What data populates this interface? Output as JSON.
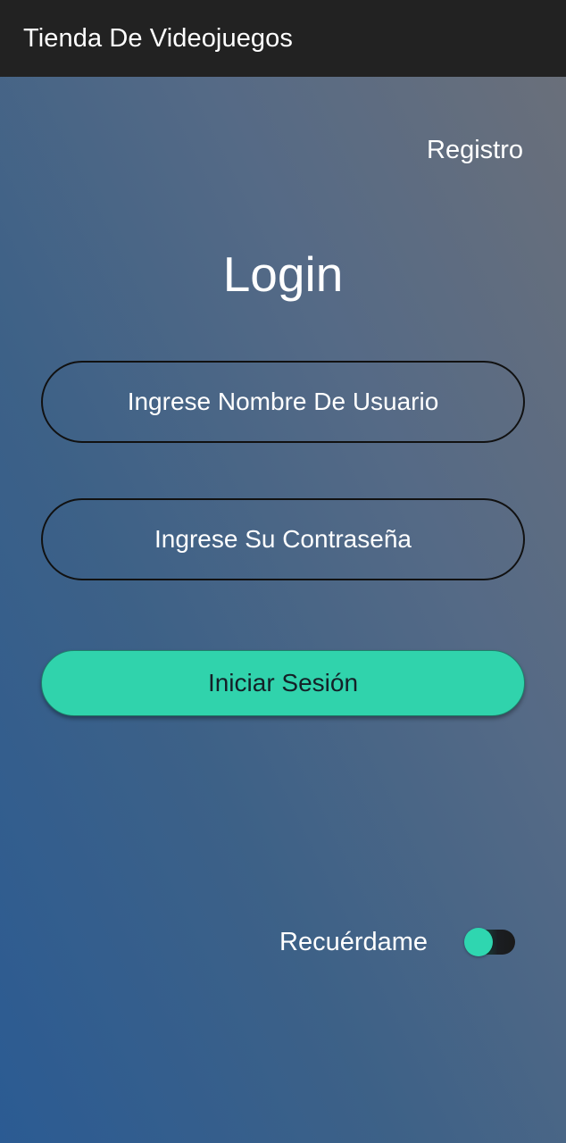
{
  "app_bar": {
    "title": "Tienda De Videojuegos"
  },
  "header": {
    "register_link": "Registro"
  },
  "login_form": {
    "title": "Login",
    "username_placeholder": "Ingrese Nombre De Usuario",
    "username_value": "",
    "password_placeholder": "Ingrese Su Contraseña",
    "password_value": "",
    "submit_label": "Iniciar Sesión"
  },
  "remember_me": {
    "label": "Recuérdame",
    "enabled": false
  },
  "colors": {
    "app_bar": "#222222",
    "accent": "#30d3ac",
    "gradient_bottom": "#2b5b93",
    "gradient_top": "#6c7079"
  }
}
